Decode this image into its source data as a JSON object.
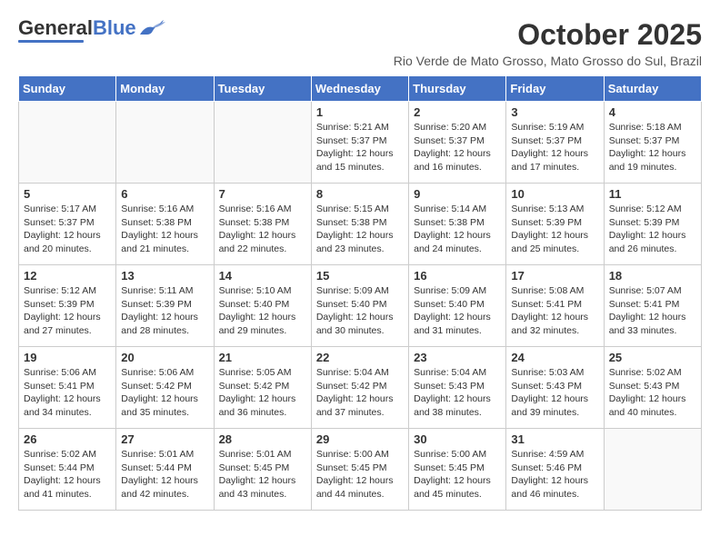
{
  "header": {
    "logo_general": "General",
    "logo_blue": "Blue",
    "month_title": "October 2025",
    "location": "Rio Verde de Mato Grosso, Mato Grosso do Sul, Brazil"
  },
  "days_of_week": [
    "Sunday",
    "Monday",
    "Tuesday",
    "Wednesday",
    "Thursday",
    "Friday",
    "Saturday"
  ],
  "weeks": [
    [
      {
        "day": "",
        "sunrise": "",
        "sunset": "",
        "daylight": ""
      },
      {
        "day": "",
        "sunrise": "",
        "sunset": "",
        "daylight": ""
      },
      {
        "day": "",
        "sunrise": "",
        "sunset": "",
        "daylight": ""
      },
      {
        "day": "1",
        "sunrise": "Sunrise: 5:21 AM",
        "sunset": "Sunset: 5:37 PM",
        "daylight": "Daylight: 12 hours and 15 minutes."
      },
      {
        "day": "2",
        "sunrise": "Sunrise: 5:20 AM",
        "sunset": "Sunset: 5:37 PM",
        "daylight": "Daylight: 12 hours and 16 minutes."
      },
      {
        "day": "3",
        "sunrise": "Sunrise: 5:19 AM",
        "sunset": "Sunset: 5:37 PM",
        "daylight": "Daylight: 12 hours and 17 minutes."
      },
      {
        "day": "4",
        "sunrise": "Sunrise: 5:18 AM",
        "sunset": "Sunset: 5:37 PM",
        "daylight": "Daylight: 12 hours and 19 minutes."
      }
    ],
    [
      {
        "day": "5",
        "sunrise": "Sunrise: 5:17 AM",
        "sunset": "Sunset: 5:37 PM",
        "daylight": "Daylight: 12 hours and 20 minutes."
      },
      {
        "day": "6",
        "sunrise": "Sunrise: 5:16 AM",
        "sunset": "Sunset: 5:38 PM",
        "daylight": "Daylight: 12 hours and 21 minutes."
      },
      {
        "day": "7",
        "sunrise": "Sunrise: 5:16 AM",
        "sunset": "Sunset: 5:38 PM",
        "daylight": "Daylight: 12 hours and 22 minutes."
      },
      {
        "day": "8",
        "sunrise": "Sunrise: 5:15 AM",
        "sunset": "Sunset: 5:38 PM",
        "daylight": "Daylight: 12 hours and 23 minutes."
      },
      {
        "day": "9",
        "sunrise": "Sunrise: 5:14 AM",
        "sunset": "Sunset: 5:38 PM",
        "daylight": "Daylight: 12 hours and 24 minutes."
      },
      {
        "day": "10",
        "sunrise": "Sunrise: 5:13 AM",
        "sunset": "Sunset: 5:39 PM",
        "daylight": "Daylight: 12 hours and 25 minutes."
      },
      {
        "day": "11",
        "sunrise": "Sunrise: 5:12 AM",
        "sunset": "Sunset: 5:39 PM",
        "daylight": "Daylight: 12 hours and 26 minutes."
      }
    ],
    [
      {
        "day": "12",
        "sunrise": "Sunrise: 5:12 AM",
        "sunset": "Sunset: 5:39 PM",
        "daylight": "Daylight: 12 hours and 27 minutes."
      },
      {
        "day": "13",
        "sunrise": "Sunrise: 5:11 AM",
        "sunset": "Sunset: 5:39 PM",
        "daylight": "Daylight: 12 hours and 28 minutes."
      },
      {
        "day": "14",
        "sunrise": "Sunrise: 5:10 AM",
        "sunset": "Sunset: 5:40 PM",
        "daylight": "Daylight: 12 hours and 29 minutes."
      },
      {
        "day": "15",
        "sunrise": "Sunrise: 5:09 AM",
        "sunset": "Sunset: 5:40 PM",
        "daylight": "Daylight: 12 hours and 30 minutes."
      },
      {
        "day": "16",
        "sunrise": "Sunrise: 5:09 AM",
        "sunset": "Sunset: 5:40 PM",
        "daylight": "Daylight: 12 hours and 31 minutes."
      },
      {
        "day": "17",
        "sunrise": "Sunrise: 5:08 AM",
        "sunset": "Sunset: 5:41 PM",
        "daylight": "Daylight: 12 hours and 32 minutes."
      },
      {
        "day": "18",
        "sunrise": "Sunrise: 5:07 AM",
        "sunset": "Sunset: 5:41 PM",
        "daylight": "Daylight: 12 hours and 33 minutes."
      }
    ],
    [
      {
        "day": "19",
        "sunrise": "Sunrise: 5:06 AM",
        "sunset": "Sunset: 5:41 PM",
        "daylight": "Daylight: 12 hours and 34 minutes."
      },
      {
        "day": "20",
        "sunrise": "Sunrise: 5:06 AM",
        "sunset": "Sunset: 5:42 PM",
        "daylight": "Daylight: 12 hours and 35 minutes."
      },
      {
        "day": "21",
        "sunrise": "Sunrise: 5:05 AM",
        "sunset": "Sunset: 5:42 PM",
        "daylight": "Daylight: 12 hours and 36 minutes."
      },
      {
        "day": "22",
        "sunrise": "Sunrise: 5:04 AM",
        "sunset": "Sunset: 5:42 PM",
        "daylight": "Daylight: 12 hours and 37 minutes."
      },
      {
        "day": "23",
        "sunrise": "Sunrise: 5:04 AM",
        "sunset": "Sunset: 5:43 PM",
        "daylight": "Daylight: 12 hours and 38 minutes."
      },
      {
        "day": "24",
        "sunrise": "Sunrise: 5:03 AM",
        "sunset": "Sunset: 5:43 PM",
        "daylight": "Daylight: 12 hours and 39 minutes."
      },
      {
        "day": "25",
        "sunrise": "Sunrise: 5:02 AM",
        "sunset": "Sunset: 5:43 PM",
        "daylight": "Daylight: 12 hours and 40 minutes."
      }
    ],
    [
      {
        "day": "26",
        "sunrise": "Sunrise: 5:02 AM",
        "sunset": "Sunset: 5:44 PM",
        "daylight": "Daylight: 12 hours and 41 minutes."
      },
      {
        "day": "27",
        "sunrise": "Sunrise: 5:01 AM",
        "sunset": "Sunset: 5:44 PM",
        "daylight": "Daylight: 12 hours and 42 minutes."
      },
      {
        "day": "28",
        "sunrise": "Sunrise: 5:01 AM",
        "sunset": "Sunset: 5:45 PM",
        "daylight": "Daylight: 12 hours and 43 minutes."
      },
      {
        "day": "29",
        "sunrise": "Sunrise: 5:00 AM",
        "sunset": "Sunset: 5:45 PM",
        "daylight": "Daylight: 12 hours and 44 minutes."
      },
      {
        "day": "30",
        "sunrise": "Sunrise: 5:00 AM",
        "sunset": "Sunset: 5:45 PM",
        "daylight": "Daylight: 12 hours and 45 minutes."
      },
      {
        "day": "31",
        "sunrise": "Sunrise: 4:59 AM",
        "sunset": "Sunset: 5:46 PM",
        "daylight": "Daylight: 12 hours and 46 minutes."
      },
      {
        "day": "",
        "sunrise": "",
        "sunset": "",
        "daylight": ""
      }
    ]
  ]
}
